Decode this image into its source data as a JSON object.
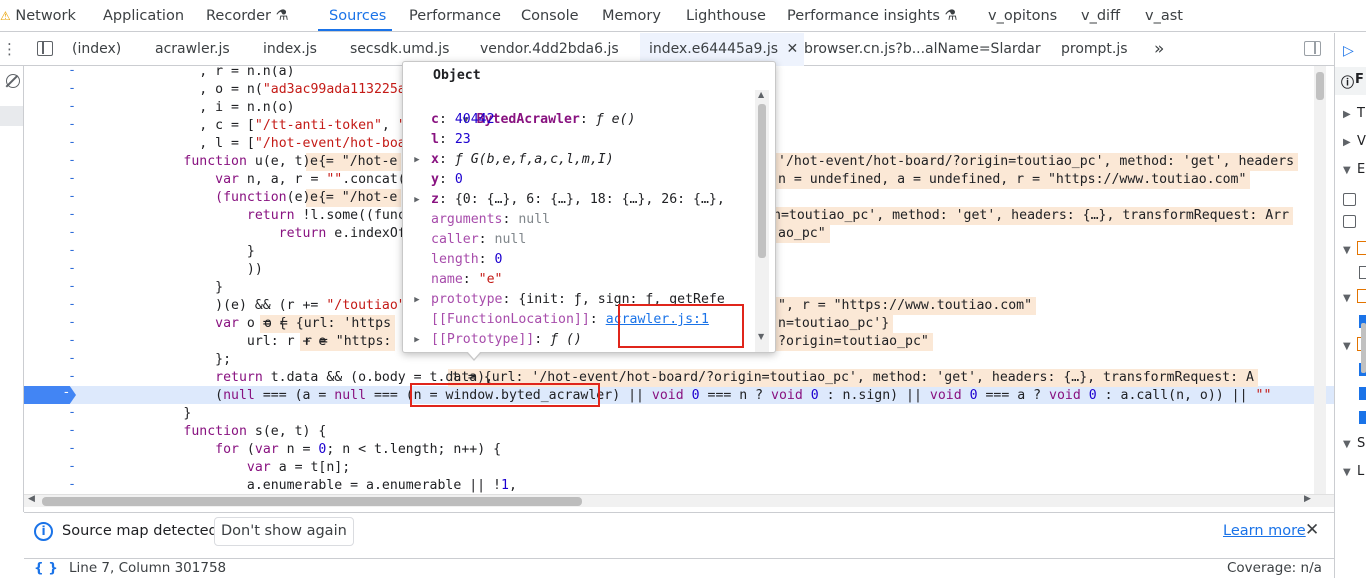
{
  "devtools_tabs": [
    {
      "label": "Network",
      "warn": true
    },
    {
      "label": "Application"
    },
    {
      "label": "Recorder",
      "flask": true
    },
    {
      "label": "Sources",
      "active": true
    },
    {
      "label": "Performance"
    },
    {
      "label": "Console"
    },
    {
      "label": "Memory"
    },
    {
      "label": "Lighthouse"
    },
    {
      "label": "Performance insights",
      "flask": true
    },
    {
      "label": "v_opitons"
    },
    {
      "label": "v_diff"
    },
    {
      "label": "v_ast"
    }
  ],
  "file_tabs": [
    "(index)",
    "acrawler.js",
    "index.js",
    "secsdk.umd.js",
    "vendor.4dd2bda6.js",
    "index.e64445a9.js",
    "browser.cn.js?b...alName=Slardar",
    "prompt.js"
  ],
  "active_file": "index.e64445a9.js",
  "more_tabs_glyph": "»",
  "code_lines": [
    {
      "pre": "            , ",
      "t": [
        [
          "r",
          "v"
        ],
        [
          " = n.n(a)",
          ""
        ]
      ]
    },
    {
      "pre": "            , ",
      "t": [
        [
          "o",
          "v"
        ],
        [
          " = n(",
          ""
        ],
        [
          "\"ad3ac99ada113225a3d8\"",
          "str"
        ],
        [
          ")",
          ""
        ]
      ]
    },
    {
      "pre": "            , ",
      "t": [
        [
          "i",
          "v"
        ],
        [
          " = n.n(o)",
          ""
        ]
      ]
    },
    {
      "pre": "            , ",
      "t": [
        [
          "c",
          "v"
        ],
        [
          " = [",
          ""
        ],
        [
          "\"/tt-anti-token\"",
          "str"
        ],
        [
          ", ",
          ""
        ],
        [
          "\"/vic",
          "str"
        ]
      ]
    },
    {
      "pre": "            , ",
      "t": [
        [
          "l",
          "v"
        ],
        [
          " = [",
          ""
        ],
        [
          "\"/hot-event/hot-board/\"",
          "str"
        ]
      ]
    },
    {
      "pre": "          ",
      "t": [
        [
          "function",
          "kw"
        ],
        [
          " u(e, t) {",
          ""
        ]
      ]
    },
    {
      "pre": "              ",
      "t": [
        [
          "var",
          "kw"
        ],
        [
          " n, a, r = ",
          ""
        ],
        [
          "\"\"",
          "str"
        ],
        [
          ".concat(loca",
          ""
        ]
      ]
    },
    {
      "pre": "              ",
      "t": [
        [
          "(function",
          "kw"
        ],
        [
          "(e) {",
          ""
        ]
      ]
    },
    {
      "pre": "                  ",
      "t": [
        [
          "return",
          "kw"
        ],
        [
          " !l.some((function",
          ""
        ]
      ]
    },
    {
      "pre": "                      ",
      "t": [
        [
          "return",
          "kw"
        ],
        [
          " e.indexOf(t)",
          ""
        ]
      ]
    },
    {
      "pre": "                  ",
      "t": [
        [
          "}",
          ""
        ]
      ]
    },
    {
      "pre": "                  ",
      "t": [
        [
          "))",
          ""
        ]
      ]
    },
    {
      "pre": "              ",
      "t": [
        [
          "}",
          ""
        ]
      ]
    },
    {
      "pre": "              ",
      "t": [
        [
          ")(e) && (r += ",
          ""
        ],
        [
          "\"/toutiao\"",
          "str"
        ],
        [
          ");",
          ""
        ]
      ]
    },
    {
      "pre": "              ",
      "t": [
        [
          "var",
          "kw"
        ],
        [
          " o = {",
          ""
        ]
      ]
    },
    {
      "pre": "                  ",
      "t": [
        [
          "url: r + e",
          ""
        ]
      ]
    },
    {
      "pre": "              ",
      "t": [
        [
          "};",
          ""
        ]
      ]
    },
    {
      "pre": "              ",
      "t": [
        [
          "return",
          "kw"
        ],
        [
          " t.data && (o.body = t.data),",
          ""
        ]
      ]
    },
    {
      "pre": "              ",
      "t": [
        [
          "(",
          ""
        ],
        [
          "null",
          "kw"
        ],
        [
          " === (a = ",
          ""
        ],
        [
          "null",
          "kw"
        ],
        [
          " === (n = ",
          ""
        ],
        [
          "window.byted_acrawler",
          ""
        ],
        [
          ")",
          ""
        ],
        [
          " || ",
          ""
        ],
        [
          "void",
          "kw"
        ],
        [
          " ",
          ""
        ],
        [
          "0",
          "num"
        ],
        [
          " === n ? ",
          ""
        ],
        [
          "void",
          "kw"
        ],
        [
          " ",
          ""
        ],
        [
          "0",
          "num"
        ],
        [
          " : n.sign) || ",
          ""
        ],
        [
          "void",
          "kw"
        ],
        [
          " ",
          ""
        ],
        [
          "0",
          "num"
        ],
        [
          " === a ? ",
          ""
        ],
        [
          "void",
          "kw"
        ],
        [
          " ",
          ""
        ],
        [
          "0",
          "num"
        ],
        [
          " : a.",
          ""
        ],
        [
          "call(n, o)) ",
          ""
        ],
        [
          "|| ",
          ""
        ],
        [
          "\"\"",
          "str"
        ]
      ]
    },
    {
      "pre": "          ",
      "t": [
        [
          "}",
          ""
        ]
      ]
    },
    {
      "pre": "          ",
      "t": [
        [
          "function",
          "kw"
        ],
        [
          " s(e, t) {",
          ""
        ]
      ]
    },
    {
      "pre": "              ",
      "t": [
        [
          "for",
          "kw"
        ],
        [
          " (",
          ""
        ],
        [
          "var",
          "kw"
        ],
        [
          " n = ",
          ""
        ],
        [
          "0",
          "num"
        ],
        [
          "; n < t.length; n++) {",
          ""
        ]
      ]
    },
    {
      "pre": "                  ",
      "t": [
        [
          "var",
          "kw"
        ],
        [
          " a = t[n];",
          ""
        ]
      ]
    },
    {
      "pre": "                  ",
      "t": [
        [
          "a.enumerable = a.enumerable || !",
          ""
        ],
        [
          "1",
          "num"
        ],
        [
          ",",
          ""
        ]
      ]
    }
  ],
  "inline_values": [
    {
      "row": 5,
      "text": "e = \"/hot-e"
    },
    {
      "row": 5,
      "text": "'/hot-event/hot-board/?origin=toutiao_pc', method: 'get', headers"
    },
    {
      "row": 6,
      "text": "n = undefined, a = undefined, r = \"https://www.toutiao.com\""
    },
    {
      "row": 7,
      "text": "e = \"/hot-e"
    },
    {
      "row": 8,
      "text": "n=toutiao_pc', method: 'get', headers: {…}, transformRequest: Arr"
    },
    {
      "row": 9,
      "text": "ao_pc\""
    },
    {
      "row": 13,
      "text": "\", r = \"https://www.toutiao.com\""
    },
    {
      "row": 14,
      "text": "o = {url: 'https"
    },
    {
      "row": 14,
      "text": "n=toutiao_pc'}"
    },
    {
      "row": 15,
      "text": "r = \"https:"
    },
    {
      "row": 15,
      "text": "?origin=toutiao_pc\""
    },
    {
      "row": 17,
      "text": "t = {url: '/hot-event/hot-board/?origin=toutiao_pc', method: 'get', headers: {…}, transformRequest: A"
    }
  ],
  "popup": {
    "title": "Object",
    "root_key": "BytedAcrawler",
    "root_value": "ƒ e()",
    "rows": [
      {
        "key": "c",
        "value": "40442",
        "type": "num",
        "expand": false,
        "bold": true
      },
      {
        "key": "l",
        "value": "23",
        "type": "num",
        "expand": false,
        "bold": true
      },
      {
        "key": "x",
        "value": "ƒ G(b,e,f,a,c,l,m,I)",
        "type": "fn",
        "expand": true,
        "bold": true
      },
      {
        "key": "y",
        "value": "0",
        "type": "num",
        "expand": false,
        "bold": true
      },
      {
        "key": "z",
        "value": "{0: {…}, 6: {…}, 18: {…}, 26: {…},",
        "type": "obj",
        "expand": true,
        "bold": true
      },
      {
        "key": "arguments",
        "value": "null",
        "type": "null",
        "expand": false,
        "bold": false
      },
      {
        "key": "caller",
        "value": "null",
        "type": "null",
        "expand": false,
        "bold": false
      },
      {
        "key": "length",
        "value": "0",
        "type": "num",
        "expand": false,
        "bold": false
      },
      {
        "key": "name",
        "value": "\"e\"",
        "type": "str",
        "expand": false,
        "bold": false
      },
      {
        "key": "prototype",
        "value": "{init: ƒ, sign: ƒ, getRefe",
        "type": "obj",
        "expand": true,
        "bold": false
      },
      {
        "key": "[[FunctionLocation]]",
        "value": "acrawler.js:1",
        "type": "link",
        "expand": false,
        "bold": false
      },
      {
        "key": "[[Prototype]]",
        "value": "ƒ ()",
        "type": "fn",
        "expand": true,
        "bold": false
      }
    ]
  },
  "info_bar": {
    "message": "Source map detected.",
    "dont_show": "Don't show again",
    "learn_more": "Learn more"
  },
  "status_bar": {
    "braces": "{ }",
    "position": "Line 7, Column 301758",
    "coverage": "Coverage: n/a"
  },
  "right_pane_letters": [
    "F",
    "T",
    "V",
    "E",
    "S",
    "L"
  ],
  "colors": {
    "accent": "#1a73e8",
    "highlight": "#fbe8d6",
    "pause": "#dde9fc",
    "red": "#e0251b"
  }
}
